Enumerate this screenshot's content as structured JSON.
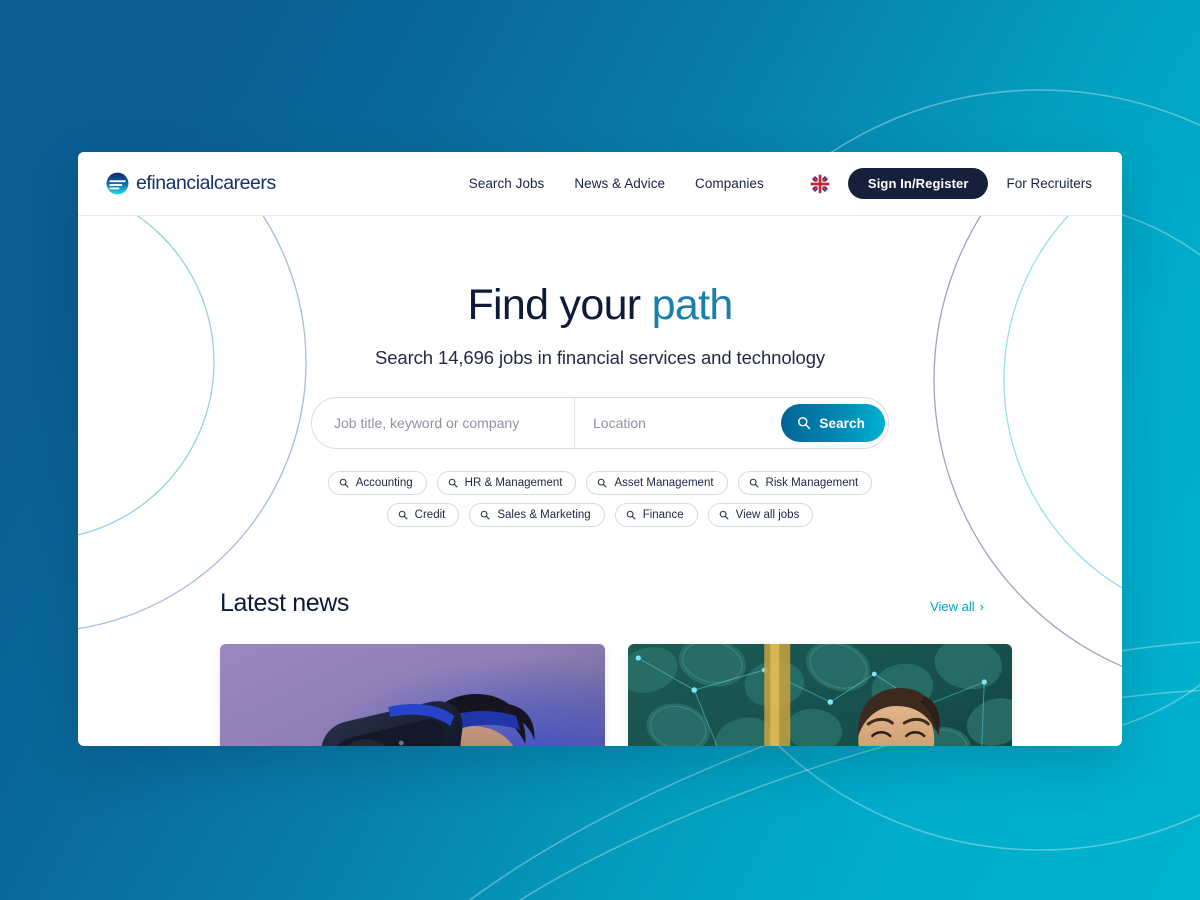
{
  "brand": {
    "name": "efinancialcareers",
    "logo_icon": "efc-circle-logo-icon"
  },
  "header": {
    "nav": [
      {
        "label": "Search Jobs",
        "name": "nav-search-jobs"
      },
      {
        "label": "News & Advice",
        "name": "nav-news-advice"
      },
      {
        "label": "Companies",
        "name": "nav-companies"
      }
    ],
    "locale_flag": "uk-flag-icon",
    "locale_label": "United Kingdom",
    "sign_in_label": "Sign In/Register",
    "recruiters_label": "For Recruiters"
  },
  "hero": {
    "title_lead": "Find your ",
    "title_accent": "path",
    "subtitle": "Search 14,696 jobs in financial services and technology",
    "job_count": "14,696"
  },
  "search": {
    "keyword_placeholder": "Job title, keyword or company",
    "keyword_value": "",
    "location_placeholder": "Location",
    "location_value": "",
    "button_label": "Search",
    "button_icon": "search-icon"
  },
  "chips": {
    "icon": "search-icon",
    "row1": [
      {
        "label": "Accounting",
        "name": "chip-accounting"
      },
      {
        "label": "HR & Management",
        "name": "chip-hr-management"
      },
      {
        "label": "Asset Management",
        "name": "chip-asset-management"
      },
      {
        "label": "Risk Management",
        "name": "chip-risk-management"
      }
    ],
    "row2": [
      {
        "label": "Credit",
        "name": "chip-credit"
      },
      {
        "label": "Sales & Marketing",
        "name": "chip-sales-marketing"
      },
      {
        "label": "Finance",
        "name": "chip-finance"
      },
      {
        "label": "View all jobs",
        "name": "chip-view-all-jobs"
      }
    ]
  },
  "news": {
    "title": "Latest news",
    "view_all_label": "View all",
    "view_all_chevron": "›",
    "cards": [
      {
        "name": "news-card-vr",
        "image_description": "Man wearing a virtual reality headset lit in blue and purple light"
      },
      {
        "name": "news-card-office",
        "image_description": "Smiling bearded man in a grey hoodie in an office with a yellow sofa and teal leafy wall"
      }
    ]
  },
  "colors": {
    "brand_navy": "#16306b",
    "accent_cyan": "#00a7cc",
    "accent_blue": "#1a7fad",
    "dark_navy": "#16203a",
    "bg_gradient_start": "#0a5e92",
    "bg_gradient_end": "#00b2ce",
    "card_background": "#ffffff"
  }
}
